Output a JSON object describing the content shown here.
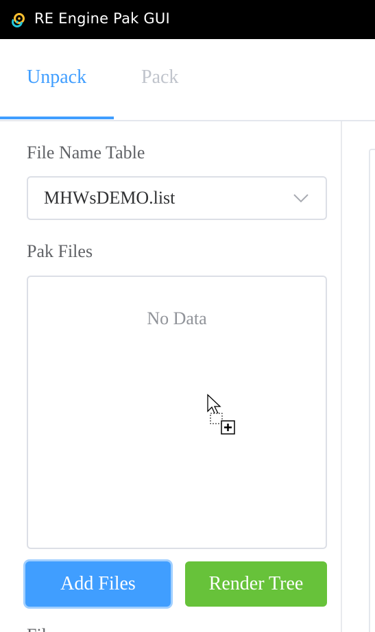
{
  "window": {
    "title": "RE Engine Pak GUI",
    "icon": "tauri-logo-icon"
  },
  "tabs": [
    {
      "label": "Unpack",
      "active": true
    },
    {
      "label": "Pack",
      "active": false
    }
  ],
  "colors": {
    "accent": "#409eff",
    "success": "#67c23a",
    "text_primary": "#303133",
    "text_regular": "#606266",
    "text_placeholder": "#909399",
    "border": "#dcdfe6"
  },
  "file_name_table": {
    "label": "File Name Table",
    "selected": "MHWsDEMO.list"
  },
  "pak_files": {
    "label": "Pak Files",
    "empty_text": "No Data"
  },
  "buttons": {
    "add_files": "Add Files",
    "render_tree": "Render Tree"
  },
  "next_section_label": "Fil"
}
